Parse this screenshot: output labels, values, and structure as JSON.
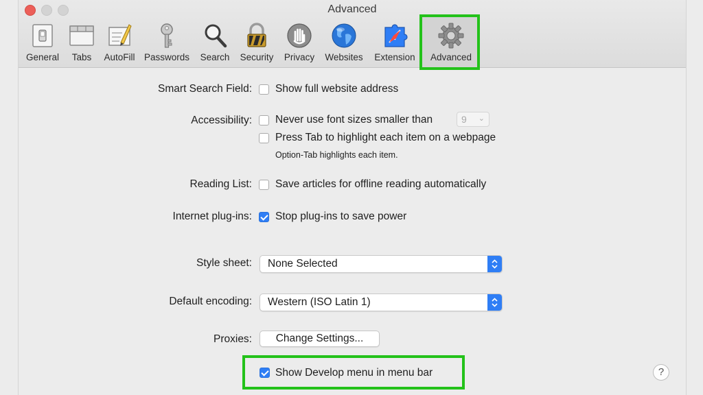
{
  "window": {
    "title": "Advanced"
  },
  "toolbar": {
    "items": [
      {
        "label": "General",
        "icon": "general-icon"
      },
      {
        "label": "Tabs",
        "icon": "tabs-icon"
      },
      {
        "label": "AutoFill",
        "icon": "autofill-icon"
      },
      {
        "label": "Passwords",
        "icon": "key-icon"
      },
      {
        "label": "Search",
        "icon": "magnifier-icon"
      },
      {
        "label": "Security",
        "icon": "padlock-icon"
      },
      {
        "label": "Privacy",
        "icon": "hand-icon"
      },
      {
        "label": "Websites",
        "icon": "globe-icon"
      },
      {
        "label": "Extension",
        "icon": "puzzle-icon"
      },
      {
        "label": "Advanced",
        "icon": "gear-icon",
        "selected": true
      }
    ]
  },
  "settings": {
    "smart_search": {
      "label": "Smart Search Field:",
      "option": "Show full website address",
      "checked": false
    },
    "accessibility": {
      "label": "Accessibility:",
      "option1": "Never use font sizes smaller than",
      "font_size": "9",
      "option1_checked": false,
      "option2": "Press Tab to highlight each item on a webpage",
      "option2_checked": false,
      "note": "Option-Tab highlights each item."
    },
    "reading_list": {
      "label": "Reading List:",
      "option": "Save articles for offline reading automatically",
      "checked": false
    },
    "plugins": {
      "label": "Internet plug-ins:",
      "option": "Stop plug-ins to save power",
      "checked": true
    },
    "style_sheet": {
      "label": "Style sheet:",
      "value": "None Selected"
    },
    "encoding": {
      "label": "Default encoding:",
      "value": "Western (ISO Latin 1)"
    },
    "proxies": {
      "label": "Proxies:",
      "button": "Change Settings..."
    },
    "develop": {
      "option": "Show Develop menu in menu bar",
      "checked": true
    }
  },
  "help": {
    "label": "?"
  },
  "colors": {
    "highlight": "#23c21a",
    "accent": "#2f7ef5"
  }
}
